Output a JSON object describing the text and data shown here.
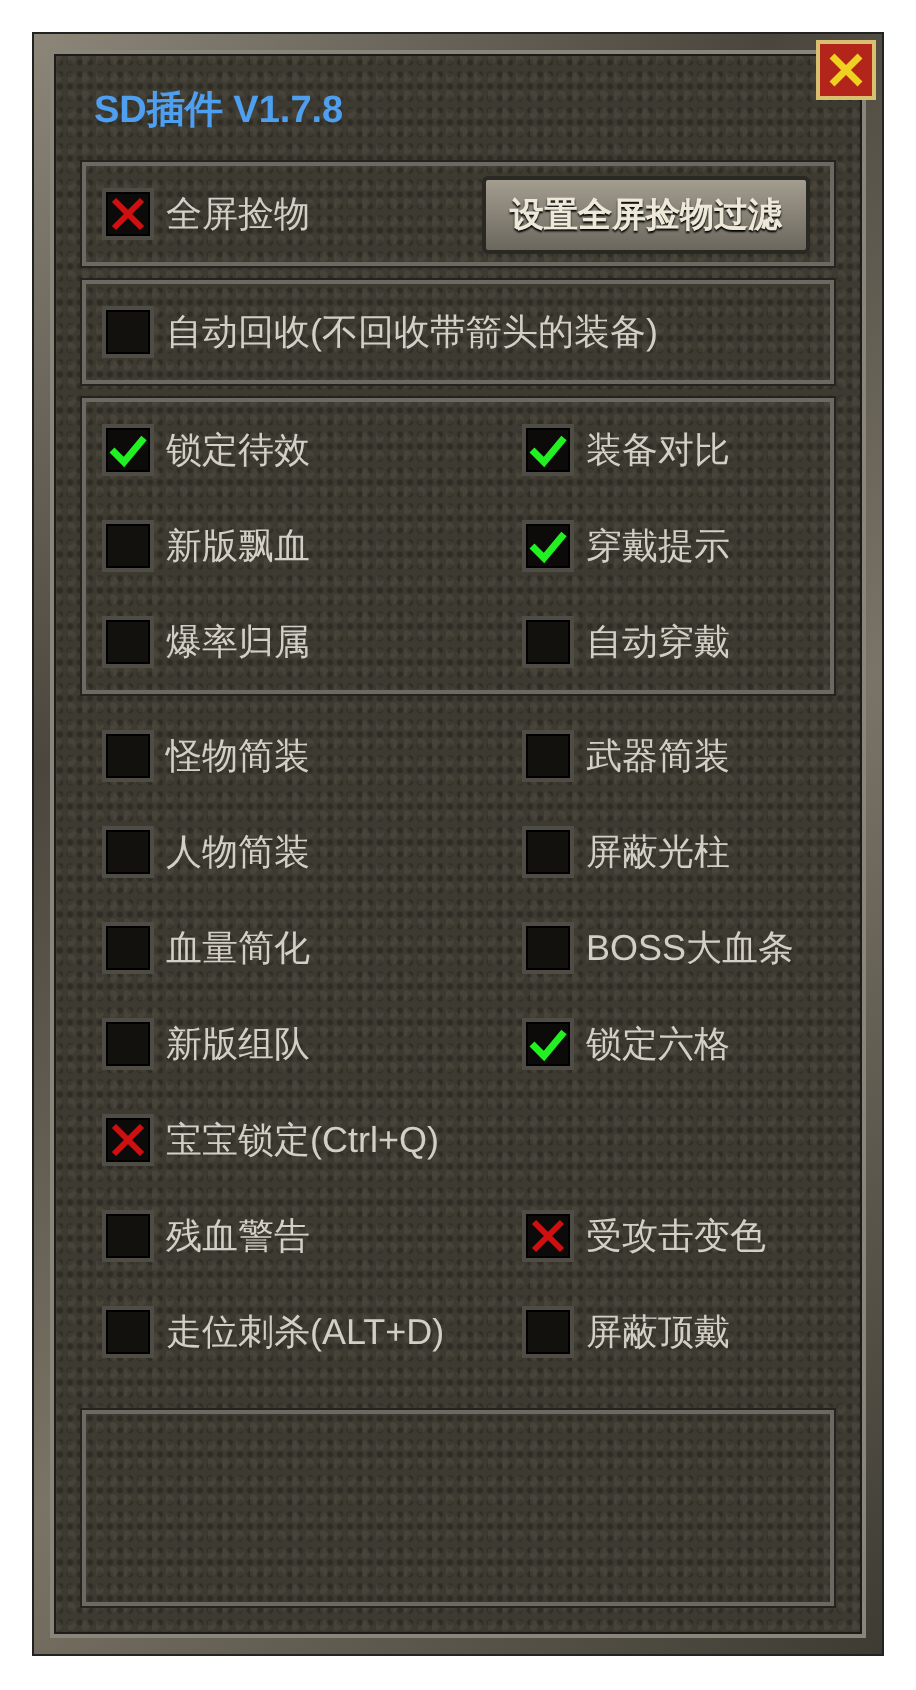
{
  "window": {
    "title": "SD插件 V1.7.8"
  },
  "sections": [
    {
      "kind": "framed",
      "rows": [
        [
          {
            "kind": "cross_checkbox",
            "label": "全屏捡物",
            "checked": true
          },
          {
            "kind": "button",
            "label": "设置全屏捡物过滤"
          }
        ]
      ]
    },
    {
      "kind": "framed",
      "rows": [
        [
          {
            "kind": "checkbox",
            "label": "自动回收(不回收带箭头的装备)",
            "checked": false
          }
        ]
      ]
    },
    {
      "kind": "framed",
      "rows": [
        [
          {
            "kind": "checkbox",
            "label": "锁定待效",
            "checked": true
          },
          {
            "kind": "checkbox",
            "label": "装备对比",
            "checked": true
          }
        ],
        [
          {
            "kind": "checkbox",
            "label": "新版飘血",
            "checked": false
          },
          {
            "kind": "checkbox",
            "label": "穿戴提示",
            "checked": true
          }
        ],
        [
          {
            "kind": "checkbox",
            "label": "爆率归属",
            "checked": false
          },
          {
            "kind": "checkbox",
            "label": "自动穿戴",
            "checked": false
          }
        ]
      ]
    },
    {
      "kind": "plain",
      "rows": [
        [
          {
            "kind": "checkbox",
            "label": "怪物简装",
            "checked": false
          },
          {
            "kind": "checkbox",
            "label": "武器简装",
            "checked": false
          }
        ],
        [
          {
            "kind": "checkbox",
            "label": "人物简装",
            "checked": false
          },
          {
            "kind": "checkbox",
            "label": "屏蔽光柱",
            "checked": false
          }
        ],
        [
          {
            "kind": "checkbox",
            "label": "血量简化",
            "checked": false
          },
          {
            "kind": "checkbox",
            "label": "BOSS大血条",
            "checked": false
          }
        ],
        [
          {
            "kind": "checkbox",
            "label": "新版组队",
            "checked": false
          },
          {
            "kind": "checkbox",
            "label": "锁定六格",
            "checked": true
          }
        ],
        [
          {
            "kind": "cross_checkbox",
            "label": "宝宝锁定(Ctrl+Q)",
            "checked": true
          }
        ],
        [
          {
            "kind": "checkbox",
            "label": "残血警告",
            "checked": false
          },
          {
            "kind": "cross_checkbox",
            "label": "受攻击变色",
            "checked": true
          }
        ],
        [
          {
            "kind": "checkbox",
            "label": "走位刺杀(ALT+D)",
            "checked": false
          },
          {
            "kind": "checkbox",
            "label": "屏蔽顶戴",
            "checked": false
          }
        ]
      ]
    }
  ]
}
